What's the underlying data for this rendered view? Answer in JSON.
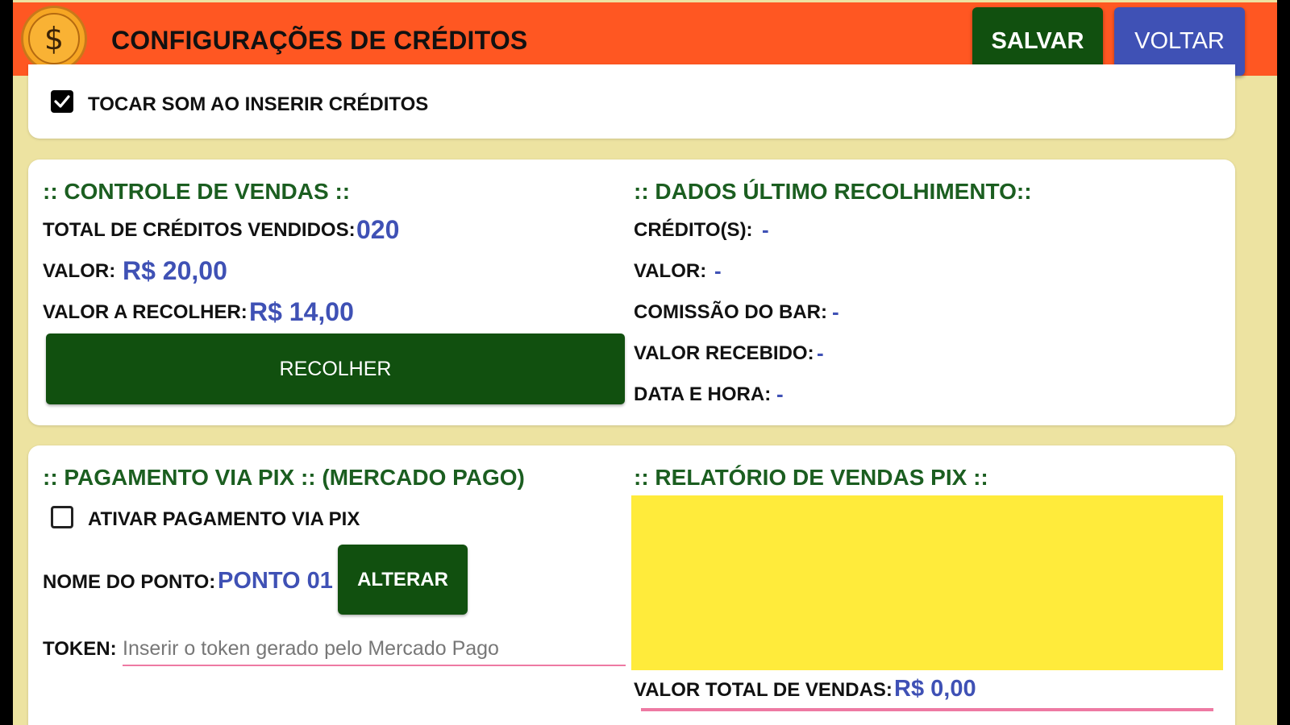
{
  "header": {
    "logo_symbol": "$",
    "title": "CONFIGURAÇÕES DE CRÉDITOS",
    "save_label": "SALVAR",
    "back_label": "VOLTAR",
    "colors": {
      "bar": "#ff5722",
      "save": "#11500f",
      "back": "#3f51b5"
    }
  },
  "sound_option": {
    "label": "TOCAR SOM AO INSERIR CRÉDITOS",
    "checked": true
  },
  "sales_control": {
    "title": ":: CONTROLE DE VENDAS ::",
    "total_credits_label": "TOTAL DE CRÉDITOS VENDIDOS:",
    "total_credits_value": "020",
    "value_label": "VALOR:",
    "value": "R$ 20,00",
    "collect_value_label": "VALOR A RECOLHER:",
    "collect_value": "R$ 14,00",
    "collect_button": "RECOLHER"
  },
  "last_collection": {
    "title": ":: DADOS ÚLTIMO RECOLHIMENTO::",
    "credits_label": "CRÉDITO(S):",
    "credits_value": "-",
    "value_label": "VALOR:",
    "value": "-",
    "bar_commission_label": "COMISSÃO DO BAR:",
    "bar_commission_value": "-",
    "received_label": "VALOR RECEBIDO:",
    "received_value": "-",
    "datetime_label": "DATA E HORA:",
    "datetime_value": "-"
  },
  "pix_payment": {
    "title": ":: PAGAMENTO VIA PIX :: (MERCADO PAGO)",
    "enable_label": "ATIVAR PAGAMENTO VIA PIX",
    "enabled": false,
    "point_name_label": "NOME DO PONTO:",
    "point_name_value": "PONTO 01",
    "change_button": "ALTERAR",
    "token_label": "TOKEN:",
    "token_value": "",
    "token_placeholder": "Inserir o token gerado pelo Mercado Pago"
  },
  "pix_report": {
    "title": ":: RELATÓRIO DE VENDAS PIX ::",
    "total_label": "VALOR TOTAL DE VENDAS:",
    "total_value": "R$ 0,00",
    "area_color": "#ffeb3b"
  }
}
